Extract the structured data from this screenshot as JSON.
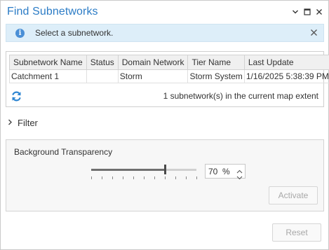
{
  "window": {
    "title": "Find Subnetworks",
    "controls": [
      "chevron-down-icon",
      "maximize-icon",
      "close-icon"
    ]
  },
  "info_bar": {
    "message": "Select a subnetwork.",
    "icon": "info-icon"
  },
  "results_table": {
    "columns": [
      "Subnetwork Name",
      "Status",
      "Domain Network",
      "Tier Name",
      "Last Update"
    ],
    "rows": [
      [
        "Catchment 1",
        "",
        "Storm",
        "Storm System",
        "1/16/2025 5:38:39 PM"
      ]
    ]
  },
  "results_footer": {
    "count_text": "1 subnetwork(s) in the current map extent",
    "refresh_icon": "refresh-icon"
  },
  "filter": {
    "label": "Filter",
    "expanded": false
  },
  "transparency": {
    "label": "Background Transparency",
    "value": 70,
    "value_text": "70",
    "unit": "%"
  },
  "buttons": {
    "activate": "Activate",
    "reset": "Reset"
  },
  "colors": {
    "title": "#2c7cc6",
    "info_background": "#ddeef9",
    "info_icon": "#4a8fd6",
    "refresh_icon": "#2f86d2"
  }
}
